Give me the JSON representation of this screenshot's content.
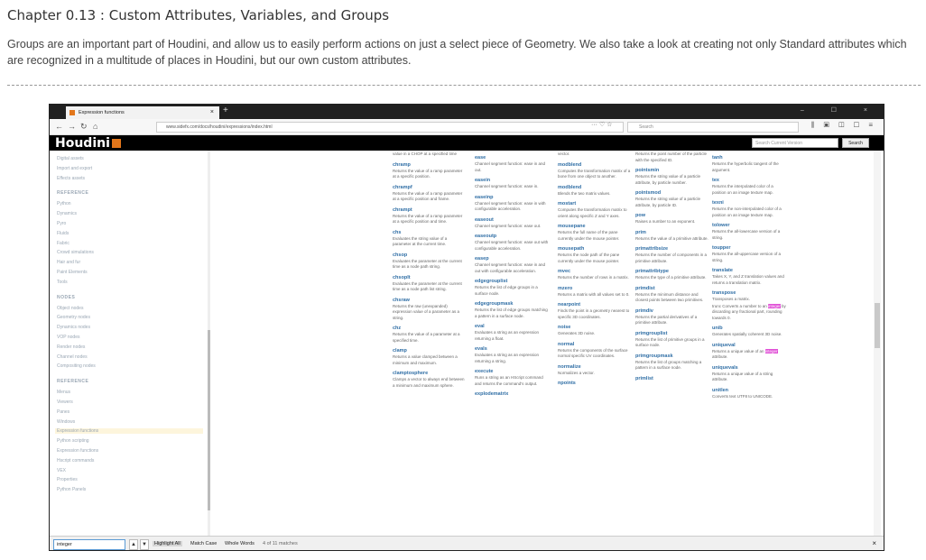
{
  "chapter": {
    "title": "Chapter 0.13 : Custom Attributes, Variables, and Groups",
    "description": "Groups are an important part of Houdini, and allow us to easily perform actions on just a select piece of Geometry. We also take a look at creating not only Standard attributes which are recognized in a multitude of places in Houdini, but our own custom attributes."
  },
  "browser": {
    "tab_title": "Expression functions",
    "tab_close": "×",
    "new_tab": "+",
    "window_controls": "–  ☐  ×",
    "url": "www.sidefx.com/docs/houdini/expressions/index.html",
    "url_menu": "··· ♡ ☆",
    "search_placeholder": "Search",
    "tools": "⫼ ▣ ◫ ☐ ≡"
  },
  "site": {
    "logo": "Houdini",
    "search_placeholder": "Search Current Version",
    "search_button": "Search"
  },
  "sidebar": {
    "items1": [
      "Digital assets",
      "Import and export",
      "Effects assets"
    ],
    "head_reference": "REFERENCE",
    "items2": [
      "Python",
      "Dynamics",
      "Pyro",
      "Fluids",
      "Fabric",
      "Crowd simulations",
      "Hair and fur",
      "Paint Elements",
      "Tools"
    ],
    "head_nodes": "NODES",
    "items3": [
      "Object nodes",
      "Geometry nodes",
      "Dynamics nodes",
      "VOP nodes",
      "Render nodes",
      "Channel nodes",
      "Compositing nodes"
    ],
    "head_reference2": "REFERENCE",
    "items4": [
      "Menus",
      "Viewers",
      "Panes",
      "Windows",
      "Expression functions",
      "Python scripting",
      "Expression functions",
      "Hscript commands",
      "VEX",
      "Properties",
      "Python Panels"
    ],
    "selected_index": 4
  },
  "columns": [
    [
      {
        "name": "",
        "desc": "value in a CHOP at a specified time"
      },
      {
        "name": "chramp",
        "desc": "Returns the value of a ramp parameter at a specific position."
      },
      {
        "name": "chrampf",
        "desc": "Returns the value of a ramp parameter at a specific position and frame."
      },
      {
        "name": "chrampt",
        "desc": "Returns the value of a ramp parameter at a specific position and time."
      },
      {
        "name": "chs",
        "desc": "Evaluates the string value of a parameter at the current time."
      },
      {
        "name": "chsop",
        "desc": "Evaluates the parameter at the current time as a node path string."
      },
      {
        "name": "chsoplt",
        "desc": "Evaluates the parameter at the current time as a node path list string."
      },
      {
        "name": "chsraw",
        "desc": "Returns the raw (unexpanded) expression value of a parameter as a string."
      },
      {
        "name": "chz",
        "desc": "Returns the value of a parameter at a specified time."
      },
      {
        "name": "clamp",
        "desc": "Returns a value clamped between a minimum and maximum."
      },
      {
        "name": "clamptosphere",
        "desc": "Clamps a vector to always end between a minimum and maximum sphere."
      }
    ],
    [
      {
        "name": "ease",
        "desc": "Channel segment function: ease in and out."
      },
      {
        "name": "easein",
        "desc": "Channel segment function: ease in."
      },
      {
        "name": "easeinp",
        "desc": "Channel segment function: ease in with configurable acceleration."
      },
      {
        "name": "easeout",
        "desc": "Channel segment function: ease out."
      },
      {
        "name": "easeoutp",
        "desc": "Channel segment function: ease out with configurable acceleration."
      },
      {
        "name": "easep",
        "desc": "Channel segment function: ease in and out with configurable acceleration."
      },
      {
        "name": "edgegrouplist",
        "desc": "Returns the list of edge groups in a surface node."
      },
      {
        "name": "edgegroupmask",
        "desc": "Returns the list of edge groups matching a pattern in a surface node."
      },
      {
        "name": "eval",
        "desc": "Evaluates a string as an expression returning a float."
      },
      {
        "name": "evals",
        "desc": "Evaluates a string as an expression returning a string."
      },
      {
        "name": "execute",
        "desc": "Runs a string as an HScript command and returns the command's output."
      },
      {
        "name": "explodematrix",
        "desc": ""
      }
    ],
    [
      {
        "name": "",
        "desc": "vector."
      },
      {
        "name": "modblend",
        "desc": "Computes the transformation matrix of a bone from one object to another."
      },
      {
        "name": "modblend",
        "desc": "Blends the two matrix values."
      },
      {
        "name": "mostart",
        "desc": "Computes the transformation matrix to orient along specific Z and Y axes."
      },
      {
        "name": "mousepane",
        "desc": "Returns the full name of the pane currently under the mouse pointer."
      },
      {
        "name": "mousepath",
        "desc": "Returns the node path of the pane currently under the mouse pointer."
      },
      {
        "name": "mvec",
        "desc": "Returns the number of rows in a matrix."
      },
      {
        "name": "mzero",
        "desc": "Returns a matrix with all values set to 0."
      },
      {
        "name": "nearpoint",
        "desc": "Finds the point in a geometry nearest to specific 3D coordinates."
      },
      {
        "name": "noise",
        "desc": "Generates 3D noise."
      },
      {
        "name": "normal",
        "desc": "Returns the components of the surface normal specific UV coordinates."
      },
      {
        "name": "normalize",
        "desc": "Normalizes a vector."
      },
      {
        "name": "npoints",
        "desc": ""
      }
    ],
    [
      {
        "name": "",
        "desc": "Returns the point number of the particle with the specified ID."
      },
      {
        "name": "pointsmin",
        "desc": "Returns the string value of a particle attribute, by particle number."
      },
      {
        "name": "pointsmod",
        "desc": "Returns the string value of a particle attribute, by particle ID."
      },
      {
        "name": "pow",
        "desc": "Raises a number to an exponent."
      },
      {
        "name": "prim",
        "desc": "Returns the value of a primitive attribute."
      },
      {
        "name": "primattribsize",
        "desc": "Returns the number of components in a primitive attribute."
      },
      {
        "name": "primattribtype",
        "desc": "Returns the type of a primitive attribute."
      },
      {
        "name": "primdist",
        "desc": "Returns the minimum distance and closest points between two primitives."
      },
      {
        "name": "primdiv",
        "desc": "Returns the partial derivatives of a primitive attribute."
      },
      {
        "name": "primgrouplist",
        "desc": "Returns the list of primitive groups in a surface node."
      },
      {
        "name": "primgroupmask",
        "desc": "Returns the list of groups matching a pattern in a surface node."
      },
      {
        "name": "primlist",
        "desc": ""
      }
    ],
    [
      {
        "name": "tanh",
        "desc": "Returns the hyperbolic tangent of the argument."
      },
      {
        "name": "tex",
        "desc": "Returns the interpolated color of a position on an image texture map."
      },
      {
        "name": "texni",
        "desc": "Returns the non-interpolated color of a position on an image texture map."
      },
      {
        "name": "tolower",
        "desc": "Returns the all-lowercase version of a string."
      },
      {
        "name": "toupper",
        "desc": "Returns the all-uppercase version of a string."
      },
      {
        "name": "translate",
        "desc": "Takes X, Y, and Z translation values and returns a translation matrix."
      },
      {
        "name": "transpose",
        "desc": "Transposes a matrix."
      },
      {
        "name": "",
        "desc_pre": "trunc\nConverts a number to an ",
        "hl": "integer",
        "desc_post": " by discarding any fractional part, rounding towards 0."
      },
      {
        "name": "unib",
        "desc": "Generates spatially coherent 3D noise."
      },
      {
        "name": "uniqueval",
        "desc_pre": "Returns a unique value of an ",
        "hl": "integer",
        "desc_post": " attribute."
      },
      {
        "name": "uniquevals",
        "desc": "Returns a unique value of a string attribute."
      },
      {
        "name": "unitlen",
        "desc": "Converts text UTF8 to UNICODE."
      }
    ]
  ],
  "findbar": {
    "query": "integer",
    "up": "▲",
    "down": "▼",
    "highlight_all": "Highlight All",
    "match_case": "Match Case",
    "whole_words": "Whole Words",
    "count": "4 of 11 matches",
    "close": "×"
  }
}
